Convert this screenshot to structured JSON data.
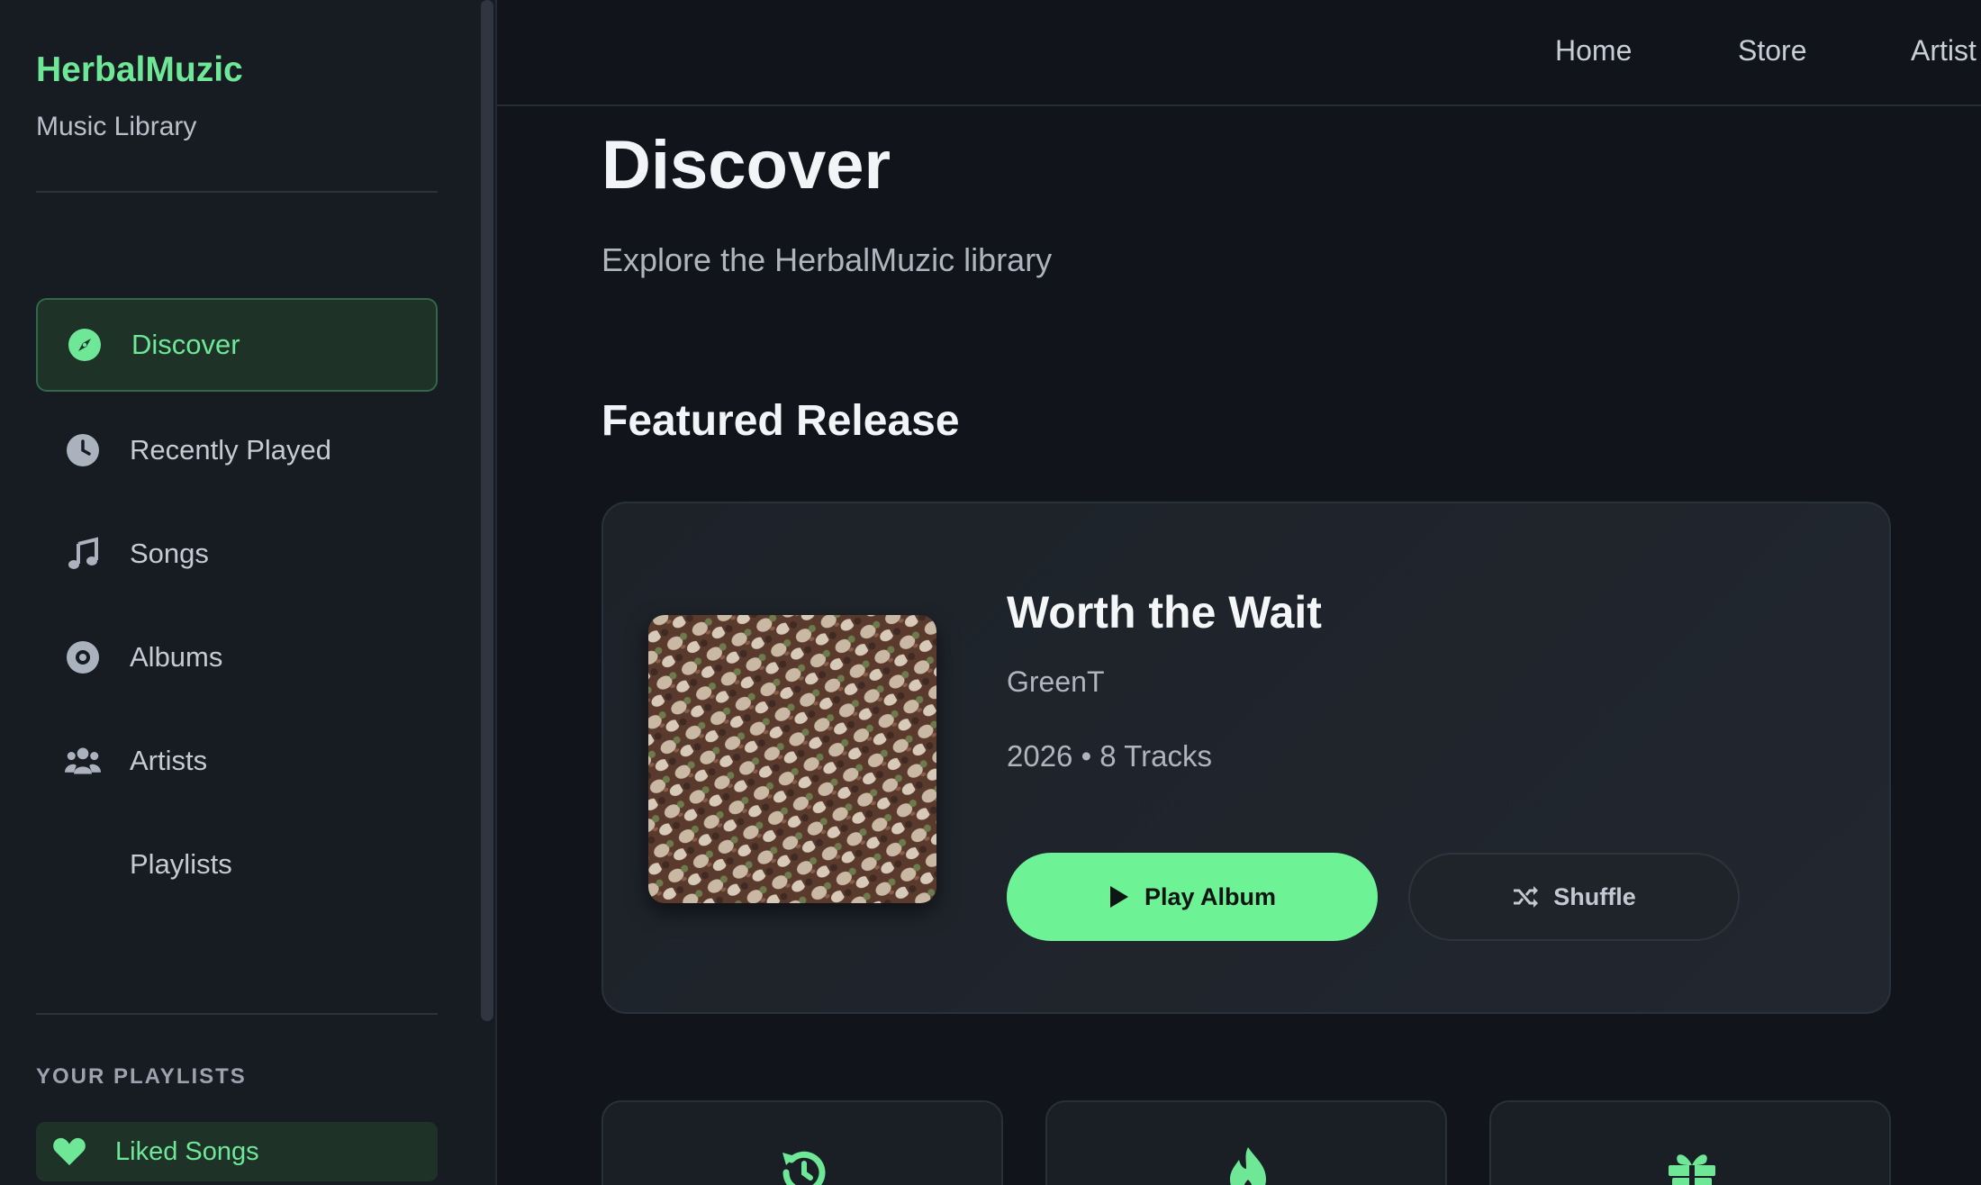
{
  "sidebar": {
    "brand": "HerbalMuzic",
    "subtitle": "Music Library",
    "nav": [
      {
        "label": "Discover",
        "icon": "compass-icon",
        "active": true
      },
      {
        "label": "Recently Played",
        "icon": "clock-icon",
        "active": false
      },
      {
        "label": "Songs",
        "icon": "music-note-icon",
        "active": false
      },
      {
        "label": "Albums",
        "icon": "disc-icon",
        "active": false
      },
      {
        "label": "Artists",
        "icon": "users-icon",
        "active": false
      },
      {
        "label": "Playlists",
        "icon": "",
        "active": false
      }
    ],
    "playlists_heading": "YOUR PLAYLISTS",
    "liked": {
      "label": "Liked Songs",
      "icon": "heart-icon"
    }
  },
  "topnav": {
    "links": [
      "Home",
      "Store",
      "Artist"
    ]
  },
  "main": {
    "title": "Discover",
    "subtitle": "Explore the HerbalMuzic library",
    "section_title": "Featured Release",
    "featured": {
      "title": "Worth the Wait",
      "artist": "GreenT",
      "meta": "2026 • 8 Tracks",
      "play_label": "Play Album",
      "shuffle_label": "Shuffle"
    },
    "quick_cards": [
      {
        "icon": "history-icon"
      },
      {
        "icon": "flame-icon"
      },
      {
        "icon": "gift-icon"
      }
    ]
  },
  "colors": {
    "accent": "#6ef296",
    "brand": "#6ee797",
    "background": "#11151b",
    "sidebar": "#171c23"
  }
}
